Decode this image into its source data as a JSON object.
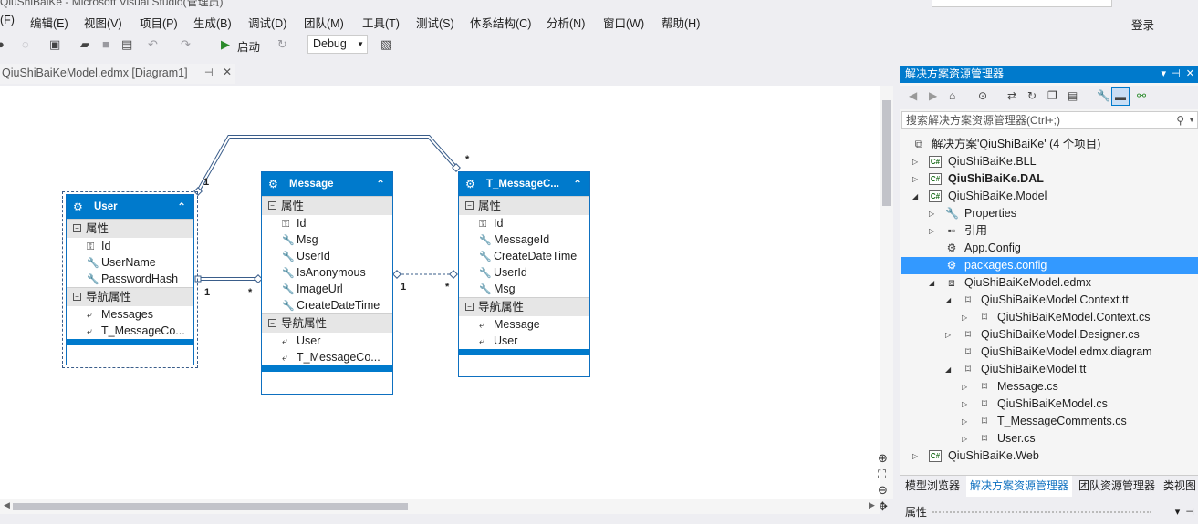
{
  "window": {
    "title": "QiuShiBaiKe - Microsoft Visual Studio(管理员)"
  },
  "menu": [
    "(F)",
    "编辑(E)",
    "视图(V)",
    "项目(P)",
    "生成(B)",
    "调试(D)",
    "团队(M)",
    "工具(T)",
    "测试(S)",
    "体系结构(C)",
    "分析(N)",
    "窗口(W)",
    "帮助(H)"
  ],
  "login": "登录",
  "toolbar": {
    "start_label": "启动",
    "config_value": "Debug"
  },
  "doc_tab": {
    "label": "QiuShiBaiKeModel.edmx [Diagram1]"
  },
  "diagram": {
    "entities": [
      {
        "name": "User",
        "section_props": "属性",
        "props": [
          "Id",
          "UserName",
          "PasswordHash"
        ],
        "section_nav": "导航属性",
        "nav": [
          "Messages",
          "T_MessageCo..."
        ]
      },
      {
        "name": "Message",
        "section_props": "属性",
        "props": [
          "Id",
          "Msg",
          "UserId",
          "IsAnonymous",
          "ImageUrl",
          "CreateDateTime"
        ],
        "section_nav": "导航属性",
        "nav": [
          "User",
          "T_MessageCo..."
        ]
      },
      {
        "name": "T_MessageC...",
        "section_props": "属性",
        "props": [
          "Id",
          "MessageId",
          "CreateDateTime",
          "UserId",
          "Msg"
        ],
        "section_nav": "导航属性",
        "nav": [
          "Message",
          "User"
        ]
      }
    ],
    "multiplicities": [
      "1",
      "*",
      "1",
      "*",
      "1",
      "*"
    ]
  },
  "solution_explorer": {
    "title": "解决方案资源管理器",
    "search_placeholder": "搜索解决方案资源管理器(Ctrl+;)",
    "tree": [
      {
        "label": "解决方案'QiuShiBaiKe' (4 个项目)",
        "icon": "solution-icon"
      },
      {
        "label": "QiuShiBaiKe.BLL",
        "icon": "csharp-project-icon"
      },
      {
        "label": "QiuShiBaiKe.DAL",
        "icon": "csharp-project-icon"
      },
      {
        "label": "QiuShiBaiKe.Model",
        "icon": "csharp-project-icon"
      },
      {
        "label": "Properties",
        "icon": "wrench-icon"
      },
      {
        "label": "引用",
        "icon": "references-icon"
      },
      {
        "label": "App.Config",
        "icon": "config-file-icon"
      },
      {
        "label": "packages.config",
        "icon": "config-file-icon"
      },
      {
        "label": "QiuShiBaiKeModel.edmx",
        "icon": "edmx-icon"
      },
      {
        "label": "QiuShiBaiKeModel.Context.tt",
        "icon": "tt-file-icon"
      },
      {
        "label": "QiuShiBaiKeModel.Context.cs",
        "icon": "cs-file-icon"
      },
      {
        "label": "QiuShiBaiKeModel.Designer.cs",
        "icon": "cs-file-icon"
      },
      {
        "label": "QiuShiBaiKeModel.edmx.diagram",
        "icon": "file-icon"
      },
      {
        "label": "QiuShiBaiKeModel.tt",
        "icon": "tt-file-icon"
      },
      {
        "label": "Message.cs",
        "icon": "cs-file-icon"
      },
      {
        "label": "QiuShiBaiKeModel.cs",
        "icon": "cs-file-icon"
      },
      {
        "label": "T_MessageComments.cs",
        "icon": "cs-file-icon"
      },
      {
        "label": "User.cs",
        "icon": "cs-file-icon"
      },
      {
        "label": "QiuShiBaiKe.Web",
        "icon": "csharp-project-icon"
      }
    ],
    "tabs": [
      "模型浏览器",
      "解决方案资源管理器",
      "团队资源管理器",
      "类视图"
    ]
  },
  "properties_panel": {
    "title": "属性"
  },
  "colors": {
    "accent": "#007acc",
    "selection": "#3399ff"
  }
}
